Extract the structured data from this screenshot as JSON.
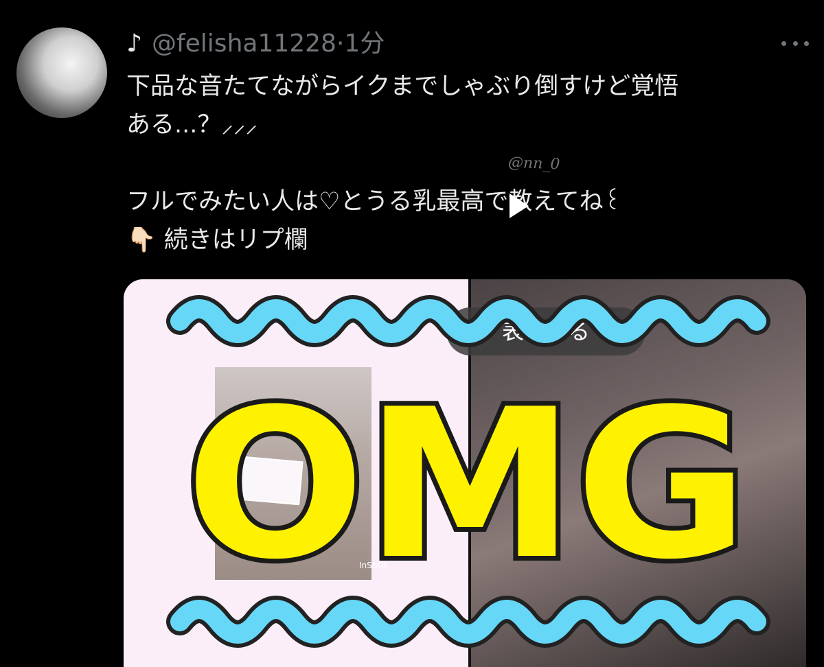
{
  "tweet": {
    "name": "♪",
    "handle": "@felisha11228",
    "separator": "·",
    "time": "1分",
    "text_lines": [
      "下品な音たてながらイクまでしゃぶり倒すけど覚悟",
      "ある...？⸝⸝⸝",
      "",
      "フルでみたい人は♡とうる乳最高で教えてね꒰",
      "👇🏻 続きはリプ欄"
    ]
  },
  "media": {
    "overlay_text": "OMG",
    "thumb_caption": "InShOt",
    "watermark": "@nn_0",
    "pill_text": "表示する"
  },
  "colors": {
    "background": "#000000",
    "text": "#e7e9ea",
    "secondary_text": "#71767b",
    "omg_fill": "#fff200",
    "wave_color": "#67d7f7"
  },
  "icons": {
    "more": "more-horizontal-icon",
    "play": "play-icon"
  }
}
